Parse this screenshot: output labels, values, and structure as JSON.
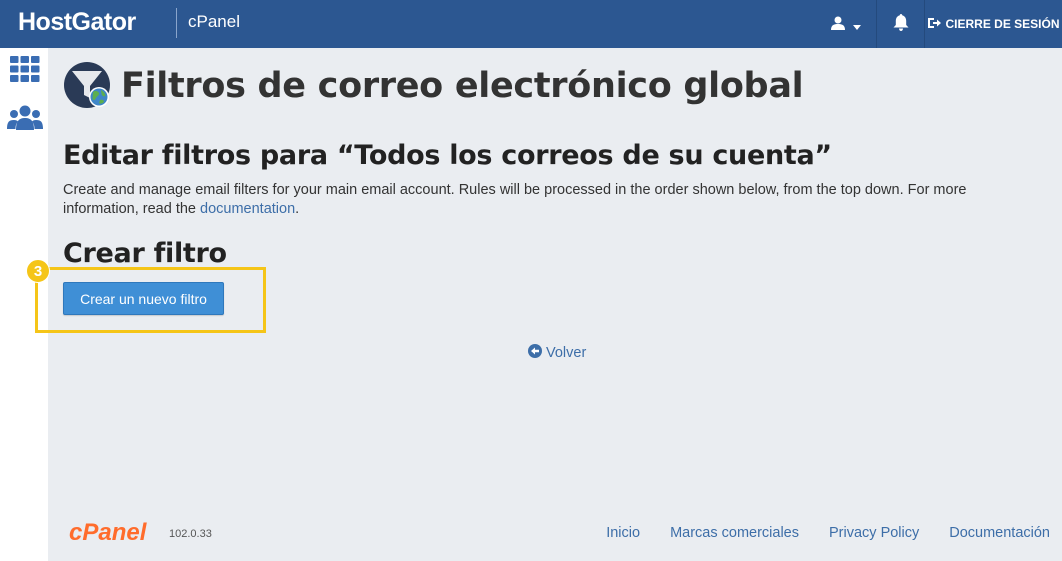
{
  "header": {
    "brand": "HostGator",
    "product": "cPanel",
    "logout_label": "CIERRE DE SESIÓN"
  },
  "sidebar": {
    "items": [
      {
        "icon": "grid-icon"
      },
      {
        "icon": "users-icon"
      }
    ]
  },
  "page": {
    "title": "Filtros de correo electrónico global",
    "section_title": "Editar filtros para “Todos los correos de su cuenta”",
    "description": "Create and manage email filters for your main email account. Rules will be processed in the order shown below, from the top down. For more information, read the ",
    "doc_link": "documentation",
    "desc_end": ".",
    "create_title": "Crear filtro",
    "create_button": "Crear un nuevo filtro",
    "step_number": "3",
    "back_label": "Volver"
  },
  "footer": {
    "logo_text": "cPanel",
    "version": "102.0.33",
    "links": [
      "Inicio",
      "Marcas comerciales",
      "Privacy Policy",
      "Documentación"
    ]
  },
  "colors": {
    "header_bg": "#2c5791",
    "main_bg": "#eaedf1",
    "accent": "#3f8fd6",
    "highlight": "#f5c518",
    "cpanel_orange": "#ff6c2c",
    "link": "#3d6ea8"
  }
}
